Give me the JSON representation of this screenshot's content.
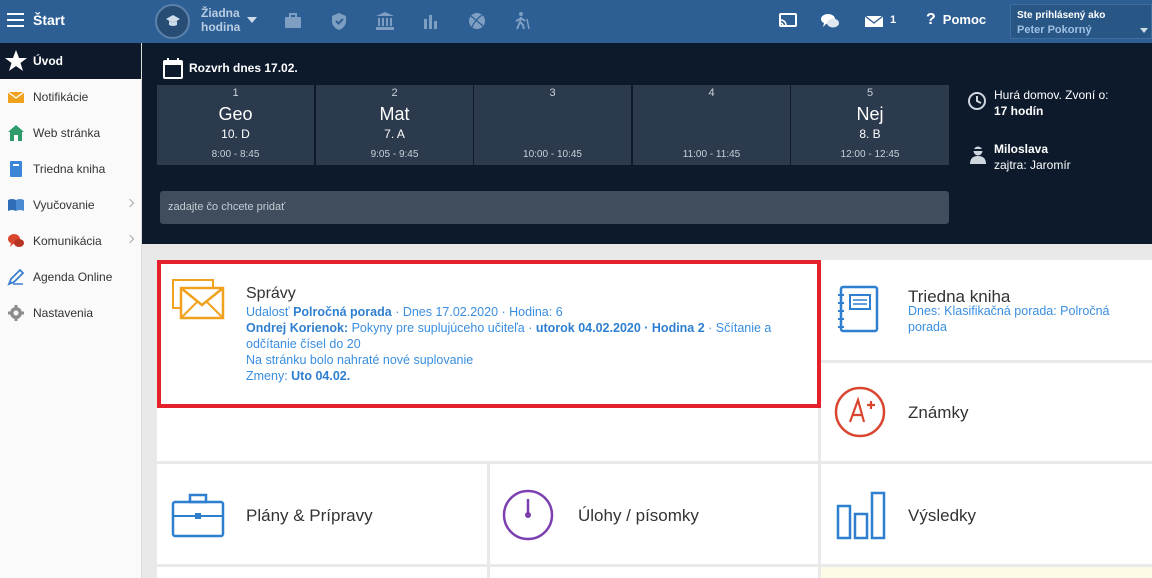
{
  "topbar": {
    "start_label": "Štart",
    "hodina_line1": "Žiadna",
    "hodina_line2": "hodina",
    "messages_count": "1",
    "help_label": "Pomoc",
    "user_caption": "Ste prihlásený ako",
    "user_name": "Peter Pokorný"
  },
  "sidebar": {
    "items": [
      {
        "label": "Úvod",
        "icon": "star-icon"
      },
      {
        "label": "Notifikácie",
        "icon": "envelope-icon"
      },
      {
        "label": "Web stránka",
        "icon": "home-icon"
      },
      {
        "label": "Triedna kniha",
        "icon": "book-icon"
      },
      {
        "label": "Vyučovanie",
        "icon": "open-book-icon"
      },
      {
        "label": "Komunikácia",
        "icon": "chat-icon"
      },
      {
        "label": "Agenda Online",
        "icon": "pen-icon"
      },
      {
        "label": "Nastavenia",
        "icon": "gear-icon"
      }
    ]
  },
  "schedule": {
    "title": "Rozvrh dnes 17.02.",
    "lessons": [
      {
        "num": "1",
        "subject": "Geo",
        "class": "10. D",
        "time": "8:00 - 8:45"
      },
      {
        "num": "2",
        "subject": "Mat",
        "class": "7. A",
        "time": "9:05 - 9:45"
      },
      {
        "num": "3",
        "subject": "",
        "class": "",
        "time": "10:00 - 10:45"
      },
      {
        "num": "4",
        "subject": "",
        "class": "",
        "time": "11:00 - 11:45"
      },
      {
        "num": "5",
        "subject": "Nej",
        "class": "8. B",
        "time": "12:00 - 12:45"
      }
    ],
    "add_placeholder": "zadajte čo chcete pridať",
    "bell_line1": "Hurá domov. Zvoní o:",
    "bell_line2": "17 hodín",
    "duty_name": "Miloslava",
    "duty_tomorrow": "zajtra: Jaromír"
  },
  "tiles": {
    "spravy": {
      "title": "Správy",
      "l1_a": "Udalosť ",
      "l1_b": "Polročná porada",
      "l1_c": " · Dnes 17.02.2020 · Hodina: 6",
      "l2_a": "Ondrej Korienok:",
      "l2_b": " Pokyny pre suplujúceho učiteľa · ",
      "l2_c": "utorok 04.02.2020 · Hodina 2",
      "l2_d": " · Sčítanie a odčítanie čísel do 20",
      "l3": "Na stránku bolo nahraté nové suplovanie",
      "l4_a": "Zmeny: ",
      "l4_b": "Uto 04.02."
    },
    "triedna_kniha": {
      "title": "Triedna kniha",
      "sub": "Dnes: Klasifikačná porada: Polročná porada"
    },
    "znamky": {
      "title": "Známky"
    },
    "plany": {
      "title": "Plány & Prípravy"
    },
    "ulohy": {
      "title": "Úlohy / písomky"
    },
    "vysledky": {
      "title": "Výsledky"
    }
  },
  "colors": {
    "topbar": "#2e5f94",
    "dark_panel": "#0c1a2c",
    "accent_blue": "#3a8ee0",
    "highlight_red": "#e4202b"
  }
}
